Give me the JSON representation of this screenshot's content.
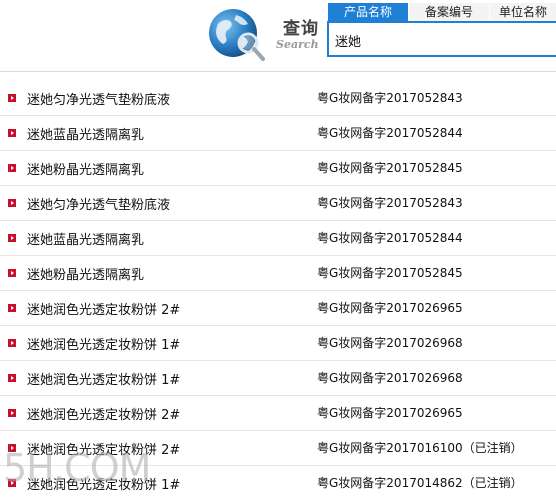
{
  "header": {
    "title": "查询",
    "subtitle": "Search",
    "tabs": [
      {
        "label": "产品名称",
        "active": true
      },
      {
        "label": "备案编号",
        "active": false
      },
      {
        "label": "单位名称",
        "active": false
      }
    ],
    "search_value": "迷她"
  },
  "colors": {
    "accent": "#1f7fd4",
    "bullet": "#c8102e"
  },
  "results": [
    {
      "name": "迷她匀净光透气垫粉底液",
      "code": "粤G妆网备字2017052843"
    },
    {
      "name": "迷她蓝晶光透隔离乳",
      "code": "粤G妆网备字2017052844"
    },
    {
      "name": "迷她粉晶光透隔离乳",
      "code": "粤G妆网备字2017052845"
    },
    {
      "name": "迷她匀净光透气垫粉底液",
      "code": "粤G妆网备字2017052843"
    },
    {
      "name": "迷她蓝晶光透隔离乳",
      "code": "粤G妆网备字2017052844"
    },
    {
      "name": "迷她粉晶光透隔离乳",
      "code": "粤G妆网备字2017052845"
    },
    {
      "name": "迷她润色光透定妆粉饼 2#",
      "code": "粤G妆网备字2017026965"
    },
    {
      "name": "迷她润色光透定妆粉饼 1#",
      "code": "粤G妆网备字2017026968"
    },
    {
      "name": "迷她润色光透定妆粉饼 1#",
      "code": "粤G妆网备字2017026968"
    },
    {
      "name": "迷她润色光透定妆粉饼 2#",
      "code": "粤G妆网备字2017026965"
    },
    {
      "name": "迷她润色光透定妆粉饼 2#",
      "code": "粤G妆网备字2017016100（已注销）"
    },
    {
      "name": "迷她润色光透定妆粉饼 1#",
      "code": "粤G妆网备字2017014862（已注销）"
    }
  ],
  "watermark": "5H.COM"
}
